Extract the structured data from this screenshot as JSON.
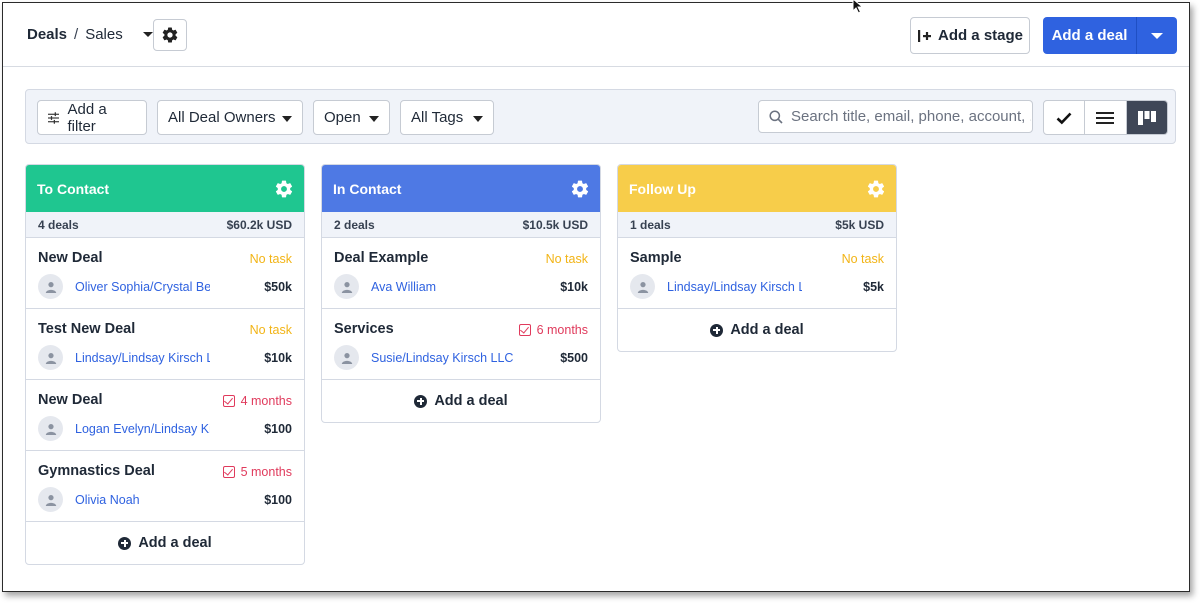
{
  "header": {
    "breadcrumb_root": "Deals",
    "breadcrumb_sep": "/",
    "breadcrumb_current": "Sales",
    "add_stage_label": "Add a stage",
    "add_deal_label": "Add a deal"
  },
  "filters": {
    "add_filter_label": "Add a filter",
    "owners_label": "All Deal Owners",
    "status_label": "Open",
    "tags_label": "All Tags",
    "search_placeholder": "Search title, email, phone, account, ..."
  },
  "colors": {
    "accent": "#2f62e0",
    "stage_to_contact": "#1fc690",
    "stage_in_contact": "#4e79e4",
    "stage_follow_up": "#f7cd4a",
    "no_task": "#f2b416",
    "overdue": "#e03a5c"
  },
  "stages": [
    {
      "name": "To Contact",
      "count": "4 deals",
      "total": "$60.2k USD",
      "add_label": "Add a deal",
      "deals": [
        {
          "title": "New Deal",
          "task": "No task",
          "task_overdue": false,
          "contact": "Oliver Sophia/Crystal Beach",
          "amount": "$50k"
        },
        {
          "title": "Test New Deal",
          "task": "No task",
          "task_overdue": false,
          "contact": "Lindsay/Lindsay Kirsch LLC",
          "amount": "$10k"
        },
        {
          "title": "New Deal",
          "task": "4 months",
          "task_overdue": true,
          "contact": "Logan Evelyn/Lindsay Kirsch LLC",
          "amount": "$100"
        },
        {
          "title": "Gymnastics Deal",
          "task": "5 months",
          "task_overdue": true,
          "contact": "Olivia Noah",
          "amount": "$100"
        }
      ]
    },
    {
      "name": "In Contact",
      "count": "2 deals",
      "total": "$10.5k USD",
      "add_label": "Add a deal",
      "deals": [
        {
          "title": "Deal Example",
          "task": "No task",
          "task_overdue": false,
          "contact": "Ava William",
          "amount": "$10k"
        },
        {
          "title": "Services",
          "task": "6 months",
          "task_overdue": true,
          "contact": "Susie/Lindsay Kirsch LLC",
          "amount": "$500"
        }
      ]
    },
    {
      "name": "Follow Up",
      "count": "1 deals",
      "total": "$5k USD",
      "add_label": "Add a deal",
      "deals": [
        {
          "title": "Sample",
          "task": "No task",
          "task_overdue": false,
          "contact": "Lindsay/Lindsay Kirsch LLC",
          "amount": "$5k"
        }
      ]
    }
  ]
}
